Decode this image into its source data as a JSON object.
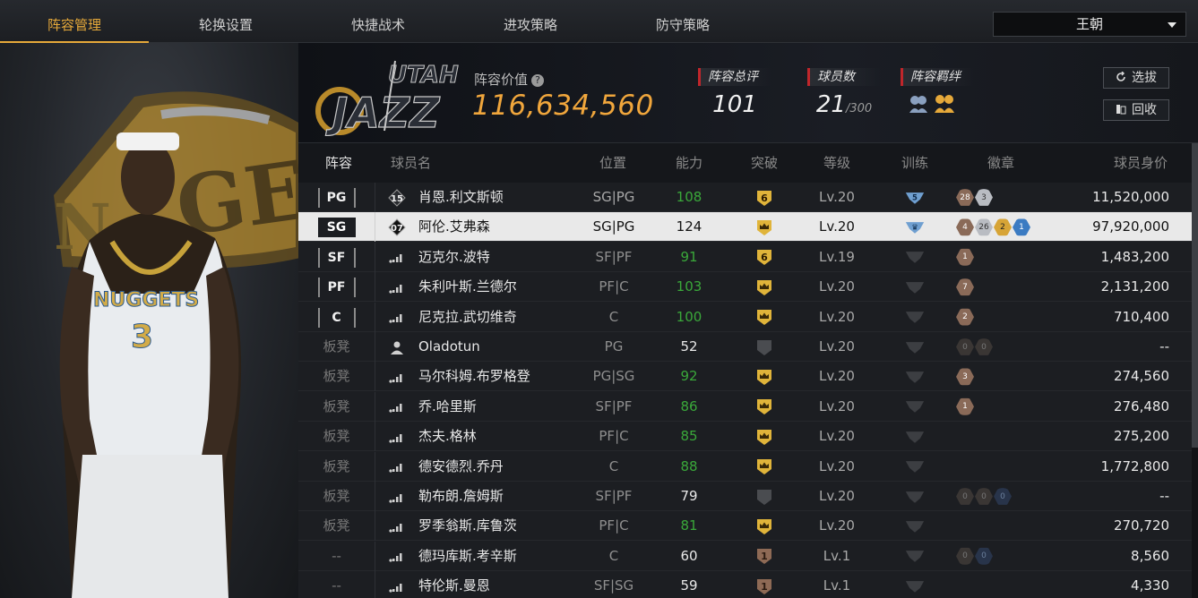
{
  "tabs": [
    {
      "label": "阵容管理",
      "active": true
    },
    {
      "label": "轮换设置",
      "active": false
    },
    {
      "label": "快捷战术",
      "active": false
    },
    {
      "label": "进攻策略",
      "active": false
    },
    {
      "label": "防守策略",
      "active": false
    }
  ],
  "team_select": {
    "value": "王朝"
  },
  "header": {
    "lineup_value_label": "阵容价值",
    "lineup_value": "116,634,560",
    "rating_label": "阵容总评",
    "rating_value": "101",
    "players_label": "球员数",
    "players_value": "21",
    "players_max": "/300",
    "bond_label": "阵容羁绊",
    "select_button": "选拔",
    "recycle_button": "回收"
  },
  "columns": [
    "阵容",
    "球员名",
    "位置",
    "能力",
    "突破",
    "等级",
    "训练",
    "徽章",
    "球员身价"
  ],
  "colors": {
    "accent": "#e6a93a",
    "value": "#f0a63c",
    "green": "#3aa83a",
    "red": "#c0262b"
  },
  "rows": [
    {
      "slot": "PG",
      "starter": true,
      "icon": "number-15-icon",
      "icon_text": "15",
      "name": "肖恩.利文斯顿",
      "pos": "SG|PG",
      "ability": "108",
      "ability_green": true,
      "break": "6",
      "level": "Lv.20",
      "train": "5",
      "badges": [
        {
          "t": "28",
          "c": "bronze"
        },
        {
          "t": "3",
          "c": "silver"
        }
      ],
      "price": "11,520,000"
    },
    {
      "slot": "SG",
      "starter": true,
      "selected": true,
      "icon": "number-07-icon",
      "icon_text": "07",
      "name": "阿伦.艾弗森",
      "pos": "SG|PG",
      "ability": "124",
      "ability_green": false,
      "break": "crown",
      "level": "Lv.20",
      "train": "crown",
      "badges": [
        {
          "t": "4",
          "c": "bronze"
        },
        {
          "t": "26",
          "c": "silver"
        },
        {
          "t": "2",
          "c": "gold"
        },
        {
          "t": "1",
          "c": "blue"
        }
      ],
      "price": "97,920,000"
    },
    {
      "slot": "SF",
      "starter": true,
      "icon": "signal-bars-icon",
      "name": "迈克尔.波特",
      "pos": "SF|PF",
      "ability": "91",
      "ability_green": true,
      "break": "6",
      "level": "Lv.19",
      "train": "",
      "badges": [
        {
          "t": "1",
          "c": "bronze"
        }
      ],
      "price": "1,483,200"
    },
    {
      "slot": "PF",
      "starter": true,
      "icon": "signal-bars-icon",
      "name": "朱利叶斯.兰德尔",
      "pos": "PF|C",
      "ability": "103",
      "ability_green": true,
      "break": "crown",
      "level": "Lv.20",
      "train": "",
      "badges": [
        {
          "t": "7",
          "c": "bronze"
        }
      ],
      "price": "2,131,200"
    },
    {
      "slot": "C",
      "starter": true,
      "icon": "signal-bars-icon",
      "name": "尼克拉.武切维奇",
      "pos": "C",
      "ability": "100",
      "ability_green": true,
      "break": "crown",
      "level": "Lv.20",
      "train": "",
      "badges": [
        {
          "t": "2",
          "c": "bronze"
        }
      ],
      "price": "710,400"
    },
    {
      "slot": "板凳",
      "starter": false,
      "icon": "person-icon",
      "name": "Oladotun",
      "pos": "PG",
      "ability": "52",
      "ability_green": false,
      "break": "grey",
      "level": "Lv.20",
      "train": "",
      "badges": [
        {
          "t": "0",
          "c": "dark"
        },
        {
          "t": "0",
          "c": "dark"
        }
      ],
      "price": "--"
    },
    {
      "slot": "板凳",
      "starter": false,
      "icon": "signal-bars-icon",
      "name": "马尔科姆.布罗格登",
      "pos": "PG|SG",
      "ability": "92",
      "ability_green": true,
      "break": "crown",
      "level": "Lv.20",
      "train": "",
      "badges": [
        {
          "t": "3",
          "c": "bronze"
        }
      ],
      "price": "274,560"
    },
    {
      "slot": "板凳",
      "starter": false,
      "icon": "signal-bars-icon",
      "name": "乔.哈里斯",
      "pos": "SF|PF",
      "ability": "86",
      "ability_green": true,
      "break": "crown",
      "level": "Lv.20",
      "train": "",
      "badges": [
        {
          "t": "1",
          "c": "bronze"
        }
      ],
      "price": "276,480"
    },
    {
      "slot": "板凳",
      "starter": false,
      "icon": "signal-bars-icon",
      "name": "杰夫.格林",
      "pos": "PF|C",
      "ability": "85",
      "ability_green": true,
      "break": "crown",
      "level": "Lv.20",
      "train": "",
      "badges": [],
      "price": "275,200"
    },
    {
      "slot": "板凳",
      "starter": false,
      "icon": "signal-bars-icon",
      "name": "德安德烈.乔丹",
      "pos": "C",
      "ability": "88",
      "ability_green": true,
      "break": "crown",
      "level": "Lv.20",
      "train": "",
      "badges": [],
      "price": "1,772,800"
    },
    {
      "slot": "板凳",
      "starter": false,
      "icon": "signal-bars-icon",
      "name": "勒布朗.詹姆斯",
      "pos": "SF|PF",
      "ability": "79",
      "ability_green": false,
      "break": "grey",
      "level": "Lv.20",
      "train": "",
      "badges": [
        {
          "t": "0",
          "c": "dark"
        },
        {
          "t": "0",
          "c": "dark"
        },
        {
          "t": "0",
          "c": "darkblue"
        }
      ],
      "price": "--"
    },
    {
      "slot": "板凳",
      "starter": false,
      "icon": "signal-bars-icon",
      "name": "罗季翁斯.库鲁茨",
      "pos": "PF|C",
      "ability": "81",
      "ability_green": true,
      "break": "crown",
      "level": "Lv.20",
      "train": "",
      "badges": [],
      "price": "270,720"
    },
    {
      "slot": "--",
      "starter": false,
      "icon": "signal-bars-icon",
      "name": "德玛库斯.考辛斯",
      "pos": "C",
      "ability": "60",
      "ability_green": false,
      "break": "1",
      "level": "Lv.1",
      "train": "",
      "badges": [
        {
          "t": "0",
          "c": "dark"
        },
        {
          "t": "0",
          "c": "darkblue"
        }
      ],
      "price": "8,560"
    },
    {
      "slot": "--",
      "starter": false,
      "icon": "signal-bars-icon",
      "name": "特伦斯.曼恩",
      "pos": "SF|SG",
      "ability": "59",
      "ability_green": false,
      "break": "1",
      "level": "Lv.1",
      "train": "",
      "badges": [],
      "price": "4,330"
    }
  ]
}
